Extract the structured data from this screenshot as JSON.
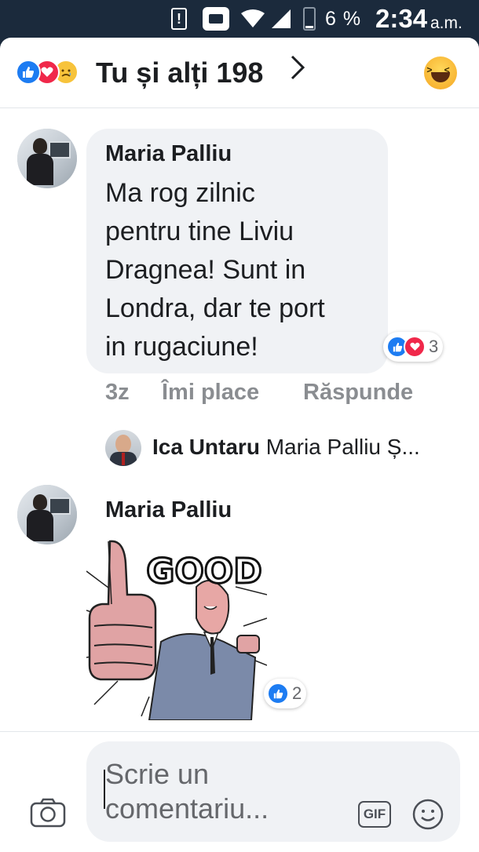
{
  "status_bar": {
    "battery_percent": "6 %",
    "time": "2:34",
    "ampm": "a.m.",
    "icons": [
      "alert-icon",
      "apk-icon",
      "wifi-icon",
      "signal-icon",
      "battery-icon"
    ]
  },
  "header": {
    "title": "Tu și alți 198",
    "reaction_icons": [
      "like-icon",
      "love-icon",
      "sad-icon"
    ],
    "action_icon": "laughing-emoji-icon"
  },
  "comments": [
    {
      "author": "Maria Palliu",
      "lines": [
        "Ma rog zilnic",
        "pentru tine Liviu",
        "Dragnea! Sunt in",
        "Londra, dar te port",
        "in rugaciune!"
      ],
      "reaction_count": "3",
      "age": "3z",
      "like_label": "Îmi place",
      "reply_label": "Răspunde"
    },
    {
      "author": "Maria Palliu",
      "sticker_text": "GOOD",
      "reaction_count": "2"
    }
  ],
  "reply_preview": {
    "author": "Ica Untaru",
    "snippet": "Maria Palliu Ș..."
  },
  "composer": {
    "placeholder": "Scrie un comentariu...",
    "gif_label": "GIF"
  },
  "colors": {
    "status_bar_bg": "#1b2a3c",
    "like_blue": "#1d7cf2",
    "love_red": "#f0284a",
    "meta_gray": "#8a8d91",
    "bubble_bg": "#f0f2f5"
  }
}
